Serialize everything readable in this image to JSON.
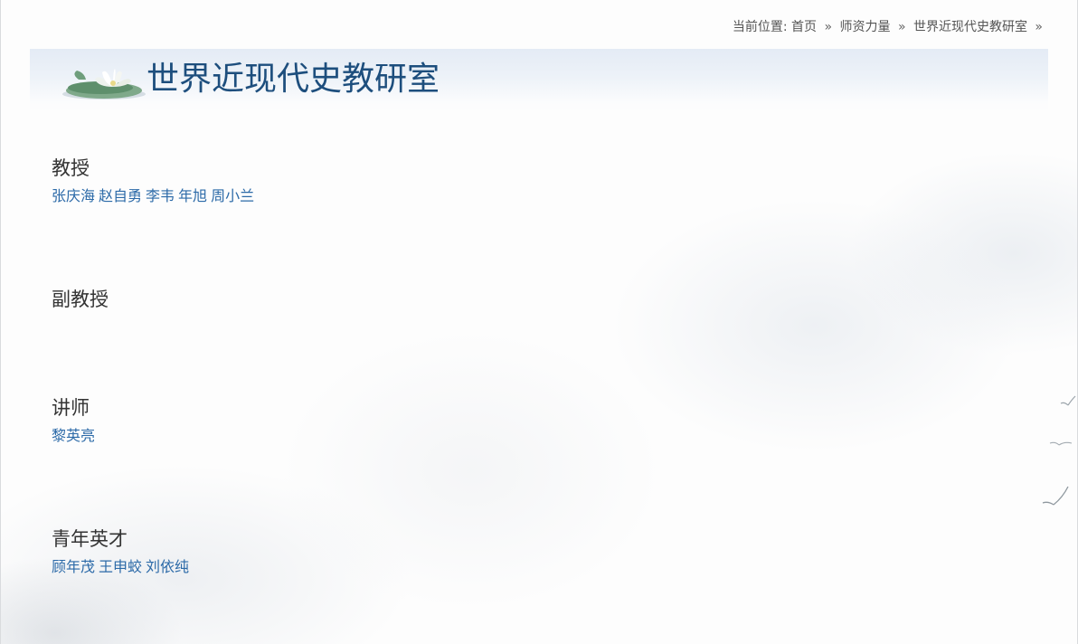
{
  "breadcrumb": {
    "prefix": "当前位置:",
    "items": [
      "首页",
      "师资力量",
      "世界近现代史教研室"
    ],
    "separator": "»"
  },
  "page_title": "世界近现代史教研室",
  "sections": [
    {
      "heading": "教授",
      "names": [
        "张庆海",
        "赵自勇",
        "李韦",
        "年旭",
        "周小兰"
      ]
    },
    {
      "heading": "副教授",
      "names": []
    },
    {
      "heading": "讲师",
      "names": [
        "黎英亮"
      ]
    },
    {
      "heading": "青年英才",
      "names": [
        "顾年茂",
        "王申蛟",
        "刘依纯"
      ]
    }
  ],
  "colors": {
    "title": "#1d4e7d",
    "link": "#2c6aa8",
    "heading": "#333333",
    "breadcrumb": "#555555"
  },
  "icons": {
    "banner": "lotus-icon"
  }
}
